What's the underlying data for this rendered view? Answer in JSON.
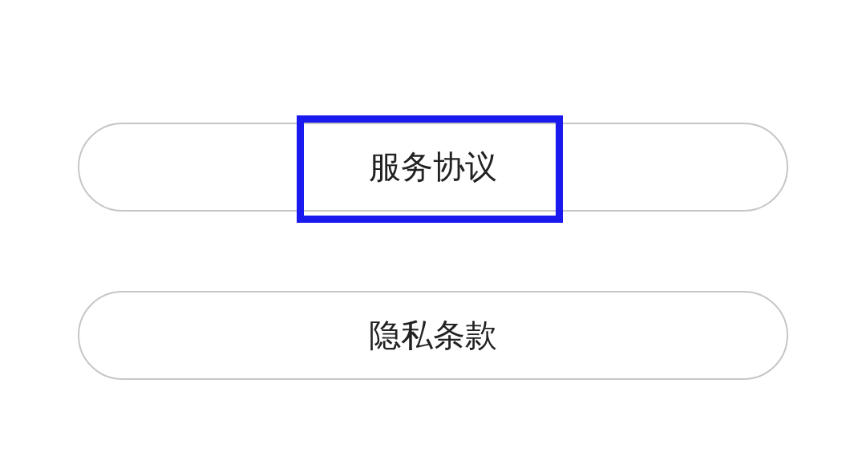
{
  "buttons": [
    {
      "label": "服务协议",
      "highlighted": true
    },
    {
      "label": "隐私条款",
      "highlighted": false
    }
  ]
}
